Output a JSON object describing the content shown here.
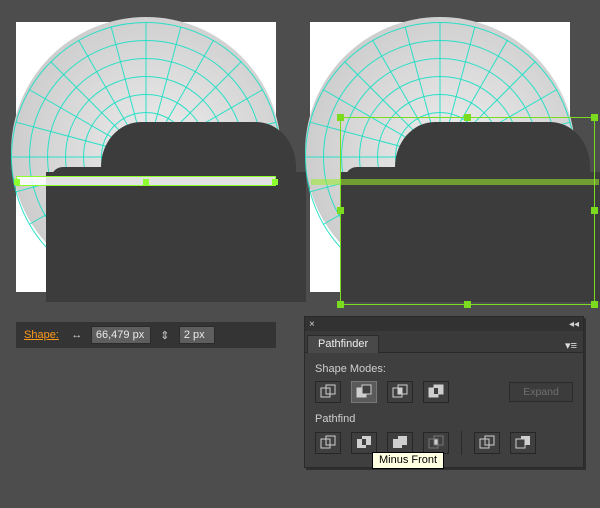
{
  "shape_bar": {
    "label": "Shape:",
    "width_value": "66,479 px",
    "height_value": "2 px"
  },
  "pathfinder_panel": {
    "tab_label": "Pathfinder",
    "section_shape_modes": "Shape Modes:",
    "section_pathfinders": "Pathfinders:",
    "section_pathfinders_truncated": "Pathfind",
    "expand_label": "Expand",
    "modes": [
      {
        "name": "unite",
        "active": false
      },
      {
        "name": "minus-front",
        "active": true
      },
      {
        "name": "intersect",
        "active": false
      },
      {
        "name": "exclude",
        "active": false
      }
    ],
    "pathfinders": [
      {
        "name": "divide"
      },
      {
        "name": "trim"
      },
      {
        "name": "merge"
      },
      {
        "name": "crop"
      },
      {
        "name": "outline"
      },
      {
        "name": "minus-back"
      }
    ]
  },
  "tooltip": "Minus Front",
  "icons": {
    "width_glyph": "↔",
    "link_glyph": "⇕",
    "close_glyph": "×",
    "collapse_glyph": "◂◂",
    "menu_glyph": "▾≡"
  }
}
